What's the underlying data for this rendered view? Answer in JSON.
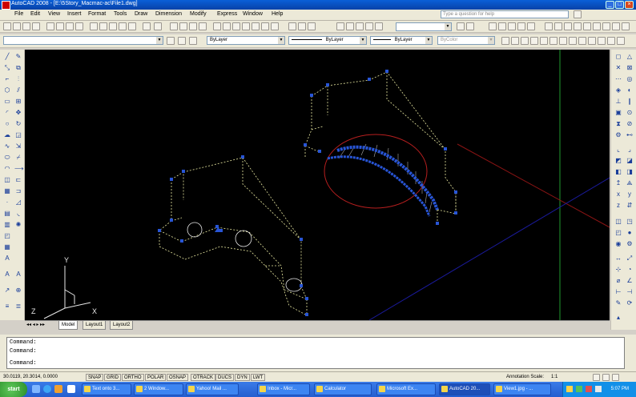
{
  "window": {
    "title": "AutoCAD 2008 - [E:\\5Story_Macmac-ac\\File1.dwg]",
    "min": "_",
    "max": "□",
    "close": "×"
  },
  "menu": {
    "items": [
      "File",
      "Edit",
      "View",
      "Insert",
      "Format",
      "Tools",
      "Draw",
      "Dimension",
      "Modify",
      "Express",
      "Window",
      "Help"
    ],
    "help_placeholder": "Type a question for help"
  },
  "props": {
    "color": "ByLayer",
    "linetype": "ByLayer",
    "lineweight": "ByLayer",
    "plotstyle": "ByColor"
  },
  "ucs": {
    "y": "Y",
    "x": "X",
    "z": "Z"
  },
  "tabs": [
    {
      "label": "Model",
      "active": true
    },
    {
      "label": "Layout1",
      "active": false
    },
    {
      "label": "Layout2",
      "active": false
    }
  ],
  "command": {
    "lines": [
      "Command:",
      "Command:",
      "Command:"
    ]
  },
  "status": {
    "coords": "30.0119, 20.3014, 0.0000",
    "toggles": [
      "SNAP",
      "GRID",
      "ORTHO",
      "POLAR",
      "OSNAP",
      "OTRACK",
      "DUCS",
      "DYN",
      "LWT"
    ],
    "annotation_scale_label": "Annotation Scale:",
    "annotation_scale": "1:1"
  },
  "taskbar": {
    "start": "start",
    "items": [
      {
        "label": "Text onto 3...",
        "active": false
      },
      {
        "label": "2 Window...",
        "active": false
      },
      {
        "label": "Yahoo! Mail ...",
        "active": false
      },
      {
        "label": "Inbox - Micr...",
        "active": false
      },
      {
        "label": "Calculator",
        "active": false
      },
      {
        "label": "Microsoft Ex...",
        "active": false
      },
      {
        "label": "AutoCAD 20...",
        "active": true
      },
      {
        "label": "View1.jpg - ...",
        "active": false
      }
    ],
    "time": "5:07 PM"
  },
  "colors": {
    "canvas": "#000000",
    "accent": "#2855d6",
    "wire": "#e8e8a0",
    "circle": "#b81f1f",
    "ucs_green": "#1f9a2e"
  }
}
